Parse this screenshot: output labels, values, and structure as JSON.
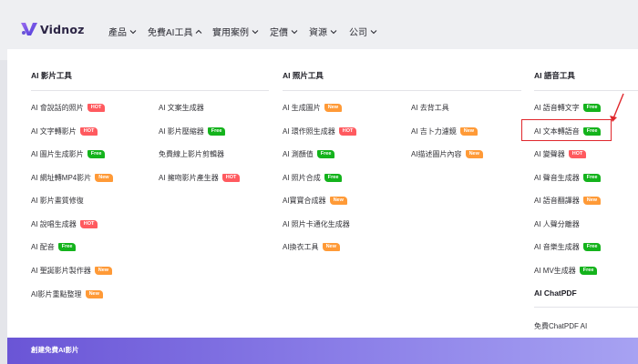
{
  "brand": {
    "name": "Vidnoz"
  },
  "nav": [
    {
      "label": "產品",
      "expanded": false
    },
    {
      "label": "免費AI工具",
      "expanded": true
    },
    {
      "label": "實用案例",
      "expanded": false
    },
    {
      "label": "定價",
      "expanded": false
    },
    {
      "label": "資源",
      "expanded": false
    },
    {
      "label": "公司",
      "expanded": false
    }
  ],
  "columns": {
    "video": {
      "title": "AI 影片工具",
      "left": [
        {
          "label": "AI 會說話的照片",
          "badge": "HOT"
        },
        {
          "label": "AI 文字轉影片",
          "badge": "HOT"
        },
        {
          "label": "AI 圖片生成影片",
          "badge": "Free"
        },
        {
          "label": "AI 網址轉MP4影片",
          "badge": "New"
        },
        {
          "label": "AI 影片畫質修復",
          "badge": ""
        },
        {
          "label": "AI 說唱生成器",
          "badge": "HOT"
        },
        {
          "label": "AI 配音",
          "badge": "Free"
        },
        {
          "label": "AI 聖誕影片製作器",
          "badge": "New"
        },
        {
          "label": "AI影片重點整理",
          "badge": "New"
        }
      ],
      "right": [
        {
          "label": "AI 文案生成器",
          "badge": ""
        },
        {
          "label": "AI 影片壓縮器",
          "badge": "Free"
        },
        {
          "label": "免費線上影片剪輯器",
          "badge": ""
        },
        {
          "label": "AI 擁吻影片產生器",
          "badge": "HOT"
        }
      ]
    },
    "photo": {
      "title": "AI 照片工具",
      "left": [
        {
          "label": "AI 生成圖片",
          "badge": "New"
        },
        {
          "label": "AI 環作照生成器",
          "badge": "HOT"
        },
        {
          "label": "AI 測顏值",
          "badge": "Free"
        },
        {
          "label": "AI 照片合成",
          "badge": "Free"
        },
        {
          "label": "AI寶寶合成器",
          "badge": "New"
        },
        {
          "label": "AI 照片卡通化生成器",
          "badge": ""
        },
        {
          "label": "AI換衣工具",
          "badge": "New"
        }
      ],
      "right": [
        {
          "label": "AI 去背工具",
          "badge": ""
        },
        {
          "label": "AI 吉卜力濾鏡",
          "badge": "New"
        },
        {
          "label": "AI描述圖片內容",
          "badge": "New"
        }
      ]
    },
    "voice": {
      "title": "AI 語音工具",
      "items": [
        {
          "label": "AI 語音轉文字",
          "badge": "Free"
        },
        {
          "label": "AI 文本轉語音",
          "badge": "Free"
        },
        {
          "label": "AI 變聲器",
          "badge": "HOT"
        },
        {
          "label": "AI 聲音生成器",
          "badge": "Free"
        },
        {
          "label": "AI 語音翻譯器",
          "badge": "New"
        },
        {
          "label": "AI 人聲分離器",
          "badge": ""
        },
        {
          "label": "AI 音樂生成器",
          "badge": "Free"
        },
        {
          "label": "AI MV生成器",
          "badge": "Free"
        }
      ],
      "chatpdf_title": "AI ChatPDF",
      "chatpdf_item": "免費ChatPDF AI"
    }
  },
  "bottom_bar": {
    "label": "創建免費AI影片"
  },
  "colors": {
    "hot": "#ff5a5f",
    "free": "#14b31c",
    "new": "#ff9a37",
    "highlight": "#e0272c",
    "brand": "#6a55d6"
  }
}
